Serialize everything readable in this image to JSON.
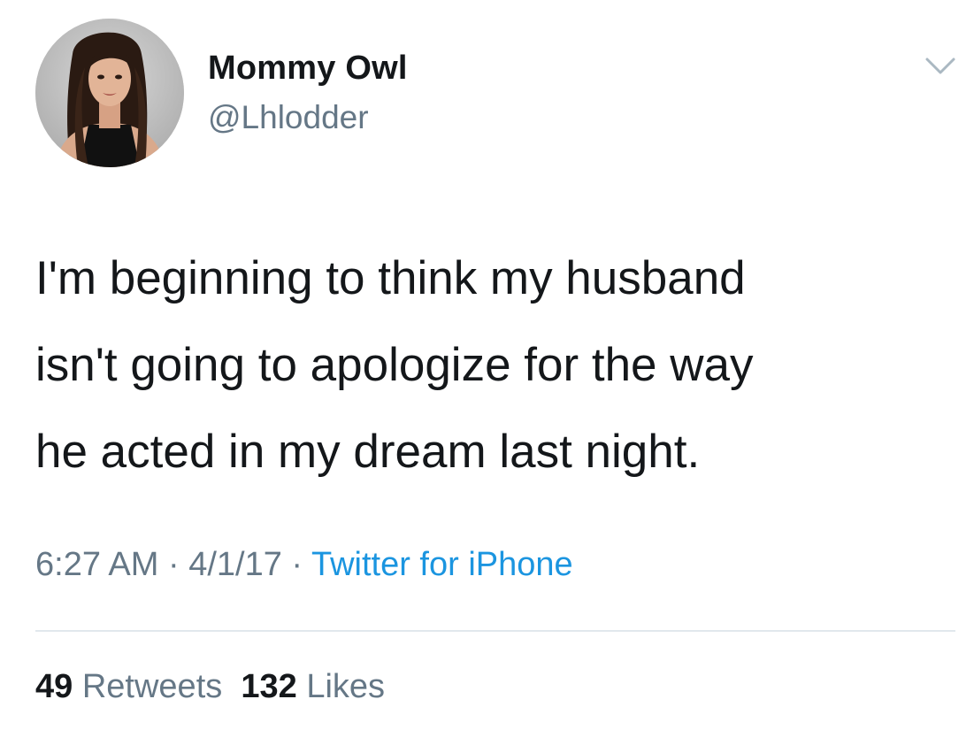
{
  "user": {
    "display_name": "Mommy Owl",
    "handle": "@Lhlodder",
    "avatar_icon": "profile-photo"
  },
  "menu": {
    "icon": "chevron-down-icon"
  },
  "tweet": {
    "text": "I'm beginning to think my husband\nisn't going to apologize for the way\nhe acted in my dream last night."
  },
  "meta": {
    "time": "6:27 AM",
    "separator": " · ",
    "date": "4/1/17",
    "source": "Twitter for iPhone"
  },
  "stats": {
    "retweets_count": "49",
    "retweets_label": "Retweets",
    "likes_count": "132",
    "likes_label": "Likes"
  },
  "colors": {
    "text": "#14171a",
    "secondary": "#657786",
    "link": "#1b95e0",
    "divider": "#e1e8ed"
  }
}
